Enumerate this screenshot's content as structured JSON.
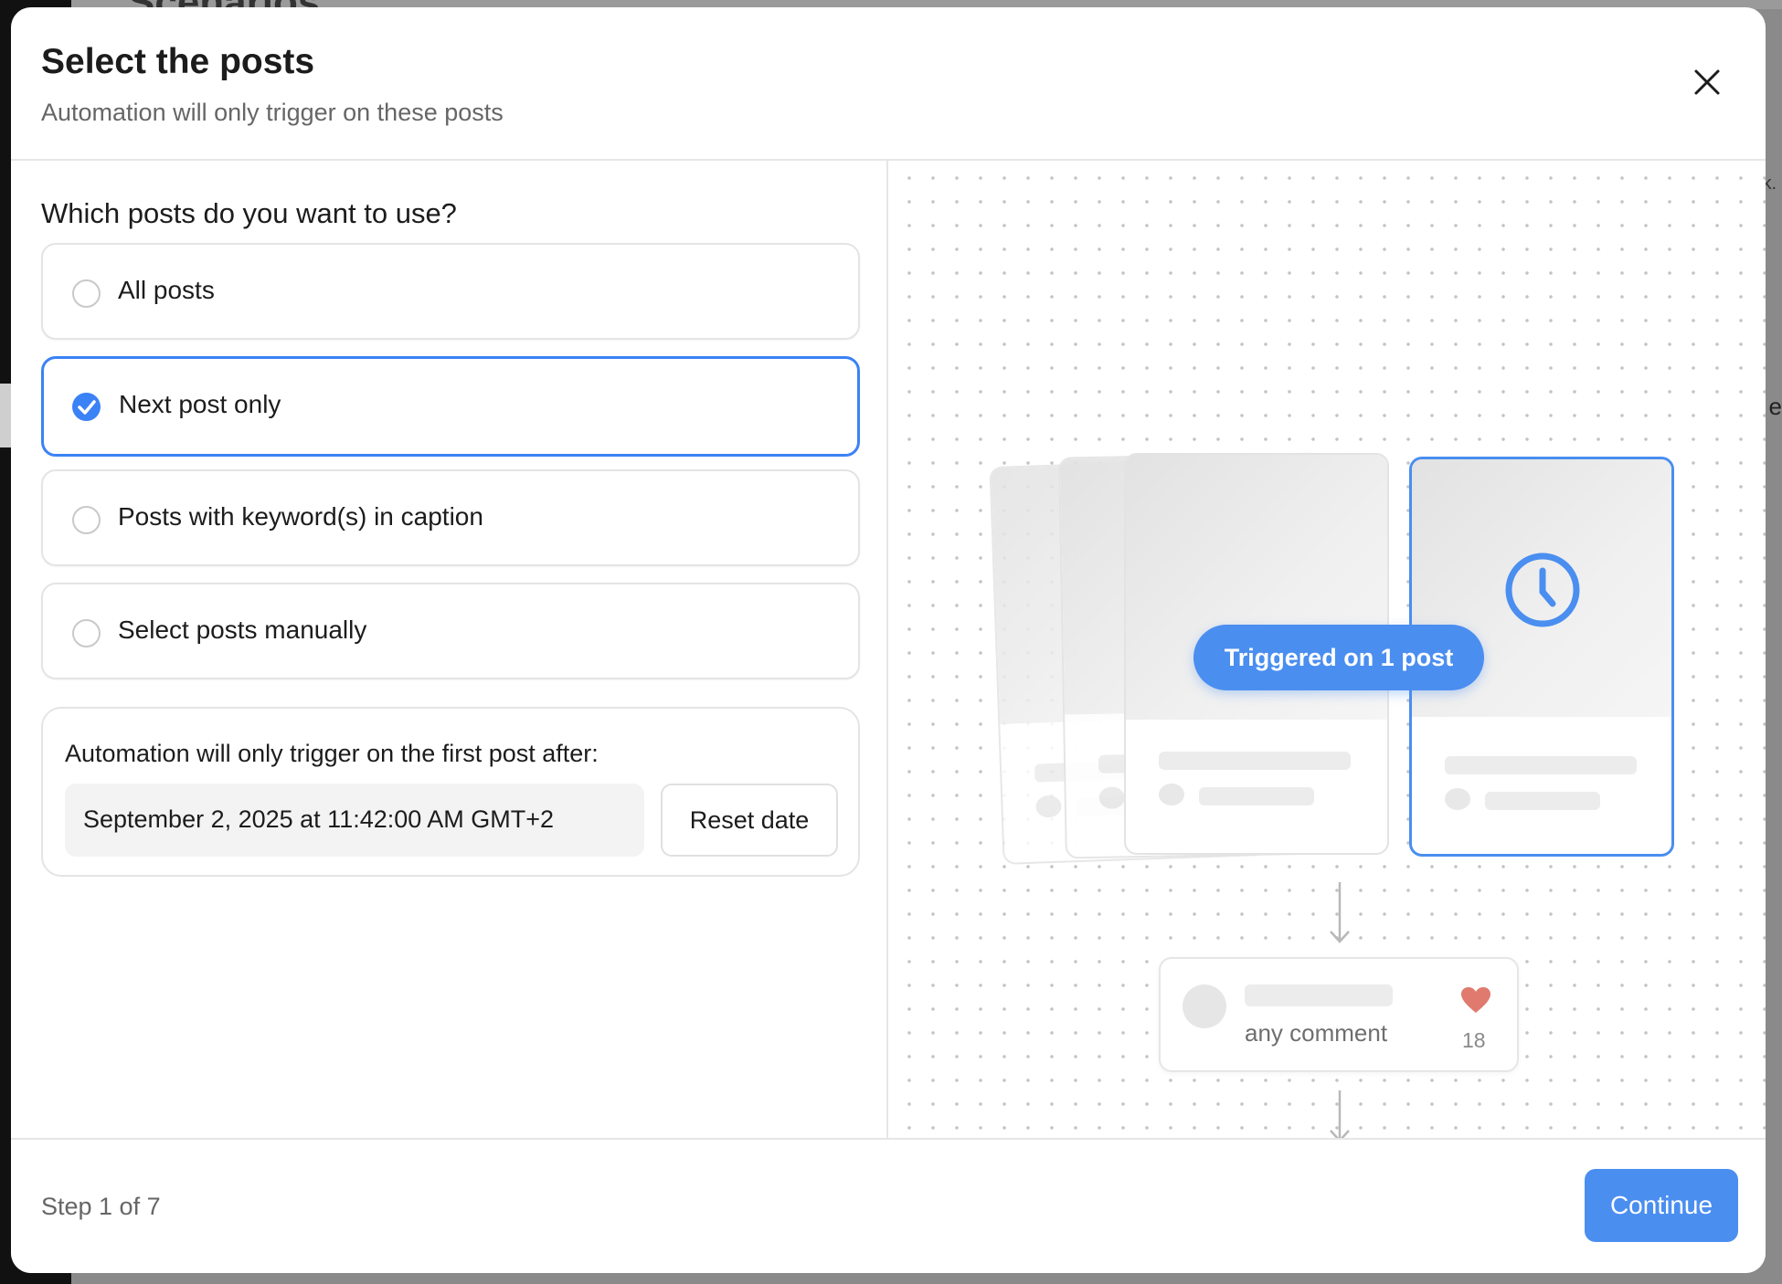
{
  "background": {
    "title": "Scenarios",
    "right_char": "e",
    "corner_char": "k."
  },
  "modal": {
    "title": "Select the posts",
    "subtitle": "Automation will only trigger on these posts",
    "close_icon": "close-icon"
  },
  "question": "Which posts do you want to use?",
  "options": [
    {
      "label": "All posts",
      "selected": false
    },
    {
      "label": "Next post only",
      "selected": true
    },
    {
      "label": "Posts with keyword(s) in caption",
      "selected": false
    },
    {
      "label": "Select posts manually",
      "selected": false
    }
  ],
  "info": {
    "text": "Automation will only trigger on the first post after:",
    "date_value": "September 2, 2025 at 11:42:00 AM GMT+2",
    "reset_label": "Reset date"
  },
  "preview": {
    "badge": "Triggered on 1 post",
    "comment_text": "any comment",
    "like_count": "18",
    "accent_color": "#4a8ef0",
    "heart_color": "#e07a6e"
  },
  "footer": {
    "step": "Step 1 of 7",
    "continue_label": "Continue"
  }
}
